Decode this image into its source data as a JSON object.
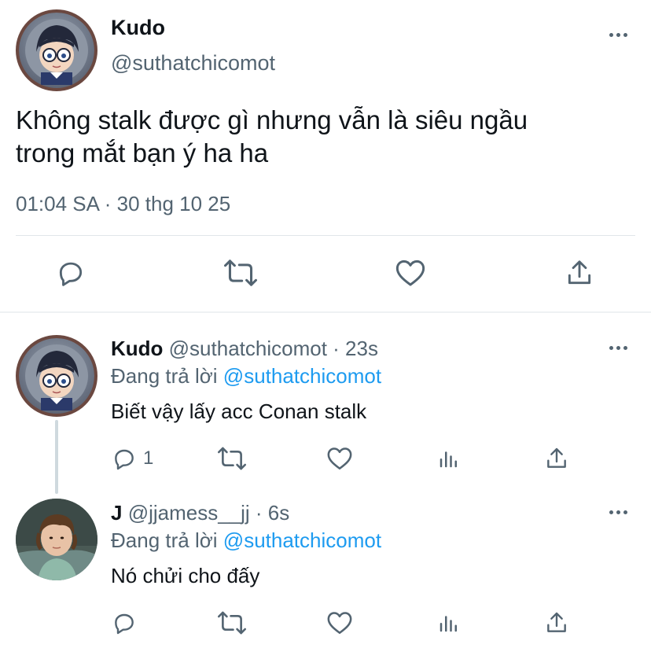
{
  "main_tweet": {
    "display_name": "Kudo",
    "handle": "@suthatchicomot",
    "text_line1": "Không stalk được gì nhưng vẫn là siêu ngầu",
    "text_line2": "trong mắt bạn ý ha ha",
    "timestamp": "01:04 SA · 30 thg 10 25"
  },
  "replies": [
    {
      "display_name": "Kudo",
      "handle": "@suthatchicomot · 23s",
      "replying_prefix": "Đang trả lời",
      "replying_to": "@suthatchicomot",
      "text": "Biết vậy lấy acc Conan stalk",
      "reply_count": "1"
    },
    {
      "display_name": "J",
      "handle": "@jjamess__jj · 6s",
      "replying_prefix": "Đang trả lời",
      "replying_to": "@suthatchicomot",
      "text": "Nó chửi cho đấy",
      "reply_count": ""
    }
  ],
  "colors": {
    "accent": "#1d9bf0",
    "secondary_text": "#536471",
    "icon": "#536471"
  }
}
